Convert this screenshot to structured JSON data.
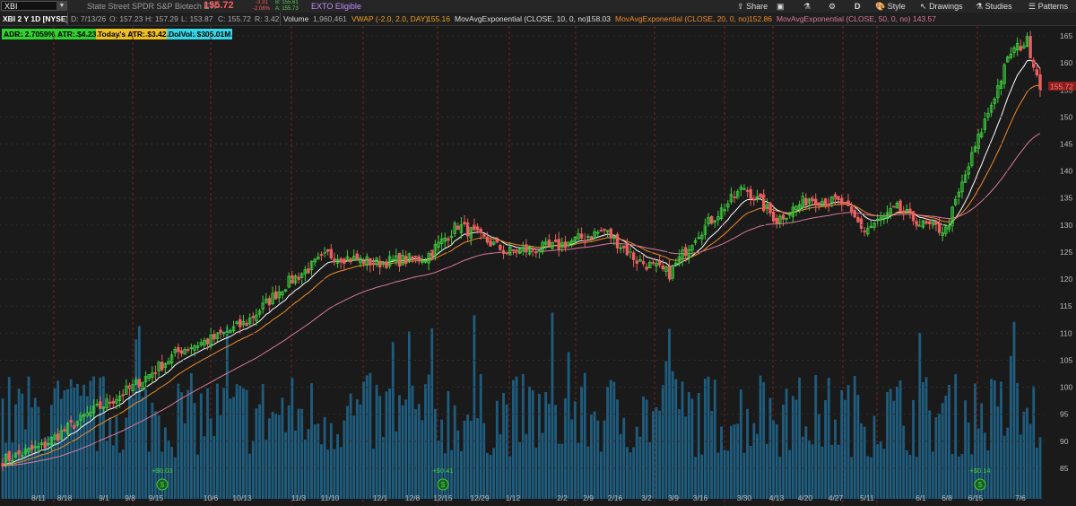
{
  "header": {
    "symbol": "XBI",
    "dropdown_icon": "chevron-down-icon",
    "description": "State Street SPDR S&P Biotech ETF",
    "last_price": "155.72",
    "net_change": "-3.31",
    "pct_change": "-2.08%",
    "bid": "B: 155.61",
    "ask": "A: 155.73",
    "exto": "EXTO Eligible",
    "share_label": "Share",
    "style_label": "Style",
    "drawings_label": "Drawings",
    "studies_label": "Studies",
    "patterns_label": "Patterns",
    "aggregation": "D"
  },
  "studybar": {
    "title": "XBI 2 Y 1D [NYSE]",
    "date": "D: 7/13/26",
    "open": "O: 157.23",
    "high": "H: 157.29",
    "low": "L: 153.87",
    "close": "C: 155.72",
    "range": "R: 3.42",
    "volume_label": "Volume",
    "volume_value": "1,960,461",
    "vwap_label": "VWAP (-2.0, 2.0, DAY)",
    "vwap_value": "155.16",
    "ema10_label": "MovAvgExponential (CLOSE, 10, 0, no)",
    "ema10_value": "158.03",
    "ema20_label": "MovAvgExponential (CLOSE, 20, 0, no)",
    "ema20_value": "152.86",
    "ema50_label": "MovAvgExponential (CLOSE, 50, 0, no)",
    "ema50_value": "143.57"
  },
  "badges": {
    "adr": "ADR: 2.7059%",
    "atr": "ATR: $4.23",
    "today_atr": "Today's ATR: $3.42",
    "dolvol": "DolVol: $305.01M"
  },
  "colors": {
    "up": "#3fcf3f",
    "down": "#e9605f",
    "volume": "#1f5d7f",
    "ema10": "#ffffff",
    "ema20": "#ef8c2a",
    "ema50": "#d9789c",
    "divider": "#7a1f1f"
  },
  "chart_data": {
    "type": "candlestick",
    "x_ticks": [
      "8/11",
      "8/18",
      "9/1",
      "9/8",
      "9/15",
      "10/6",
      "10/13",
      "11/3",
      "11/10",
      "12/1",
      "12/8",
      "12/15",
      "12/29",
      "1/12",
      "2/2",
      "2/9",
      "2/16",
      "3/2",
      "3/9",
      "3/16",
      "3/30",
      "4/13",
      "4/20",
      "4/27",
      "5/11",
      "6/1",
      "6/8",
      "6/15",
      "7/6"
    ],
    "y_ticks": [
      "165",
      "160",
      "155",
      "150",
      "145",
      "140",
      "135",
      "130",
      "125",
      "120",
      "115",
      "110",
      "105",
      "100",
      "95",
      "90",
      "85"
    ],
    "ylim": [
      83,
      166
    ],
    "last_price_label": "155.72",
    "dividends": [
      "+$0.03",
      "+$0.41",
      "+$0.14"
    ],
    "close_anchors": [
      [
        0,
        86.5
      ],
      [
        12,
        89
      ],
      [
        25,
        94.5
      ],
      [
        40,
        100
      ],
      [
        55,
        107
      ],
      [
        65,
        109
      ],
      [
        75,
        112
      ],
      [
        87,
        119
      ],
      [
        100,
        124.5
      ],
      [
        115,
        123
      ],
      [
        130,
        124
      ],
      [
        140,
        130
      ],
      [
        155,
        125
      ],
      [
        170,
        126
      ],
      [
        185,
        129
      ],
      [
        195,
        123.5
      ],
      [
        205,
        121
      ],
      [
        213,
        128
      ],
      [
        228,
        137
      ],
      [
        238,
        131
      ],
      [
        248,
        135
      ],
      [
        258,
        134
      ],
      [
        265,
        129
      ],
      [
        275,
        133
      ],
      [
        283,
        130
      ],
      [
        290,
        129
      ],
      [
        300,
        146
      ],
      [
        310,
        162
      ],
      [
        315,
        164
      ],
      [
        319,
        156
      ]
    ]
  }
}
